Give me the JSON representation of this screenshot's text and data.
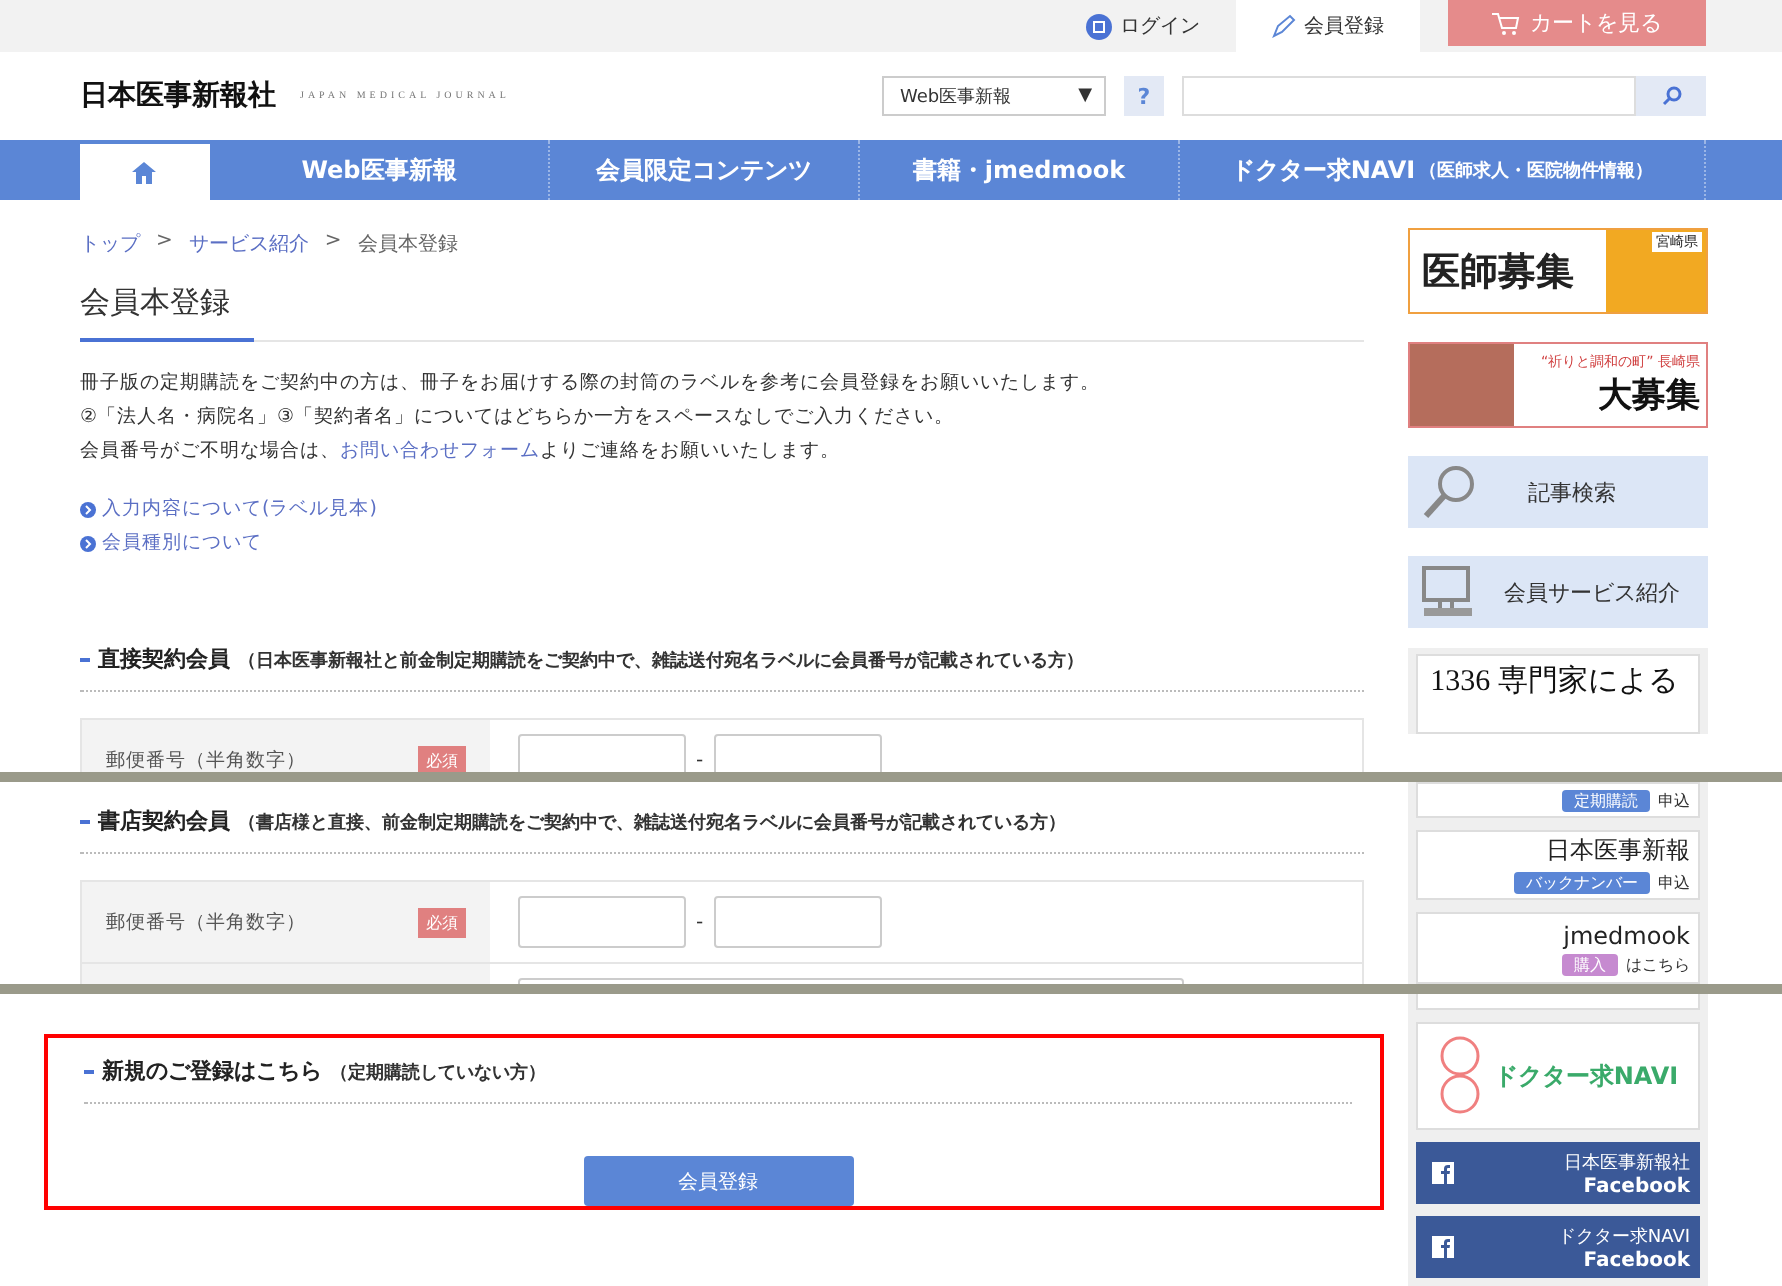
{
  "top_bar": {
    "login": "ログイン",
    "register": "会員登録",
    "cart": "カートを見る"
  },
  "header": {
    "logo": "日本医事新報社",
    "logo_sub": "JAPAN MEDICAL JOURNAL",
    "select": "Web医事新報",
    "select_arrow": "▼",
    "help": "?"
  },
  "nav": [
    {
      "kind": "home",
      "selected": true
    },
    {
      "kind": "text",
      "label": "Web医事新報",
      "selected": false
    },
    {
      "kind": "text",
      "label": "会員限定コンテンツ",
      "selected": false
    },
    {
      "kind": "text",
      "label": "書籍・jmedmook",
      "selected": false
    },
    {
      "kind": "text",
      "label": "ドクター求NAVI",
      "note": "（医師求人・医院物件情報）",
      "selected": false
    }
  ],
  "breadcrumb": [
    {
      "kind": "link",
      "label": "トップ"
    },
    {
      "kind": "sep",
      "label": ">"
    },
    {
      "kind": "link",
      "label": "サービス紹介"
    },
    {
      "kind": "sep",
      "label": ">"
    },
    {
      "kind": "current",
      "label": "会員本登録"
    }
  ],
  "page_title": "会員本登録",
  "intro": [
    "冊子版の定期購読をご契約中の方は、冊子をお届けする際の封筒のラベルを参考に会員登録をお願いいたします。",
    "②「法人名・病院名」③「契約者名」についてはどちらか一方をスペースなしでご入力ください。"
  ],
  "intro_contact": {
    "before": "会員番号がご不明な場合は、",
    "link": "お問い合わせフォーム",
    "after": "よりご連絡をお願いいたします。"
  },
  "info_links": [
    "入力内容について(ラベル見本)",
    "会員種別について"
  ],
  "sections": [
    {
      "title": "直接契約会員",
      "note": "（日本医事新報社と前金制定期購読をご契約中で、雑誌送付宛名ラベルに会員番号が記載されている方）",
      "rows": [
        {
          "kind": "postal",
          "label": "郵便番号（半角数字）",
          "required": "必須",
          "separator": "-"
        }
      ]
    },
    {
      "title": "書店契約会員",
      "note": "（書店様と直接、前金制定期購読をご契約中で、雑誌送付宛名ラベルに会員番号が記載されている方）",
      "rows": [
        {
          "kind": "postal",
          "label": "郵便番号（半角数字）",
          "required": "必須",
          "separator": "-"
        },
        {
          "kind": "text"
        }
      ]
    }
  ],
  "new_registration": {
    "title": "新規のご登録はこちら",
    "note": "（定期購読していない方）",
    "button": "会員登録",
    "highlighted": true
  },
  "sidebar_top": [
    {
      "kind": "ad_orange",
      "title": "医師募集",
      "tag": "宮崎県"
    },
    {
      "kind": "ad_church",
      "tag": "“祈りと調和の町” 長崎県",
      "title": "大募集"
    },
    {
      "kind": "search",
      "label": "記事検索"
    },
    {
      "kind": "service",
      "label": "会員サービス紹介"
    },
    {
      "kind": "book_cut",
      "title": "1336 専門家による"
    }
  ],
  "sidebar_middle": [
    {
      "kind": "badge_cut",
      "badge": "定期購読",
      "action": "申込"
    },
    {
      "kind": "book",
      "title": "日本医事新報",
      "badge": "バックナンバー",
      "action": "申込",
      "color": "#5b86d6"
    },
    {
      "kind": "book",
      "title": "jmedmook",
      "badge": "購入",
      "action": "はこちら",
      "color": "#c68ad0"
    }
  ],
  "sidebar_bottom": [
    {
      "kind": "ad_navi",
      "title": "ドクター求NAVI"
    },
    {
      "kind": "facebook",
      "label": "日本医事新報社",
      "sub": "Facebook"
    },
    {
      "kind": "facebook",
      "label": "ドクター求NAVI",
      "sub": "Facebook"
    }
  ]
}
